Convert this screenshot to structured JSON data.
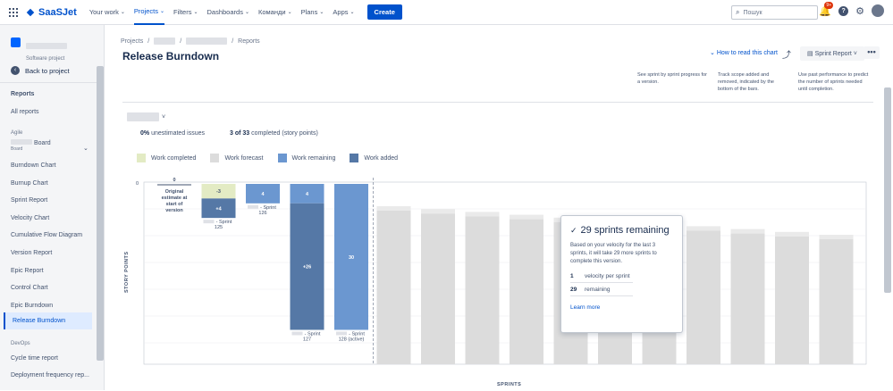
{
  "topnav": {
    "brand": "SaaSJet",
    "items": [
      {
        "label": "Your work",
        "active": false
      },
      {
        "label": "Projects",
        "active": true
      },
      {
        "label": "Filters",
        "active": false
      },
      {
        "label": "Dashboards",
        "active": false
      },
      {
        "label": "Команди",
        "active": false
      },
      {
        "label": "Plans",
        "active": false
      },
      {
        "label": "Apps",
        "active": false
      }
    ],
    "create_label": "Create",
    "search_placeholder": "Пошук",
    "notifications_badge": "9+"
  },
  "sidebar": {
    "project_type": "Software project",
    "back_label": "Back to project",
    "reports_heading": "Reports",
    "all_reports": "All reports",
    "agile_heading": "Agile",
    "board_label": "Board",
    "board_sub": "Board",
    "agile_items": [
      "Burndown Chart",
      "Burnup Chart",
      "Sprint Report",
      "Velocity Chart",
      "Cumulative Flow Diagram",
      "Version Report",
      "Epic Report",
      "Control Chart",
      "Epic Burndown",
      "Release Burndown"
    ],
    "devops_heading": "DevOps",
    "devops_items": [
      "Cycle time report",
      "Deployment frequency rep..."
    ]
  },
  "main": {
    "breadcrumb_projects": "Projects",
    "breadcrumb_reports": "Reports",
    "title": "Release Burndown",
    "howto_label": "How to read this chart",
    "report_button": "Sprint Report",
    "tips": [
      "See sprint by sprint progress for a version.",
      "Track scope added and removed, indicated by the bottom of the bars.",
      "Use past performance to predict the number of sprints needed until completion."
    ],
    "unestimated_pct": "0%",
    "unestimated_text": "unestimated issues",
    "completed_count": "3 of 33",
    "completed_text": "completed (story points)",
    "legend": [
      {
        "label": "Work completed",
        "color": "#e3ebc4"
      },
      {
        "label": "Work forecast",
        "color": "#dcdcdc"
      },
      {
        "label": "Work remaining",
        "color": "#6b97d0"
      },
      {
        "label": "Work added",
        "color": "#5578a6"
      }
    ],
    "y_axis_label": "STORY POINTS",
    "x_axis_label": "SPRINTS"
  },
  "chart_data": {
    "type": "bar",
    "y_tick": "0",
    "columns": [
      {
        "label": "Original estimate at start of version",
        "top_value": "0",
        "segments": []
      },
      {
        "label": "- Sprint 125",
        "segments": [
          {
            "kind": "completed",
            "value": -3,
            "text": "-3"
          },
          {
            "kind": "added",
            "value": 4,
            "text": "+4"
          }
        ]
      },
      {
        "label": "- Sprint 126",
        "segments": [
          {
            "kind": "remaining",
            "value": 4,
            "text": "4"
          }
        ]
      },
      {
        "label": "- Sprint 127",
        "segments": [
          {
            "kind": "remaining",
            "value": 4,
            "text": "4"
          },
          {
            "kind": "added",
            "value": 26,
            "text": "+26"
          }
        ]
      },
      {
        "label": "- Sprint 128 (active)",
        "segments": [
          {
            "kind": "remaining",
            "value": 30,
            "text": "30"
          }
        ]
      }
    ],
    "forecast_columns": 11
  },
  "popup": {
    "title": "29 sprints remaining",
    "desc": "Based on your velocity for the last 3 sprints, it will take 29 more sprints to complete this version.",
    "velocity_value": "1",
    "velocity_label": "velocity per sprint",
    "remaining_value": "29",
    "remaining_label": "remaining",
    "link": "Learn more"
  }
}
